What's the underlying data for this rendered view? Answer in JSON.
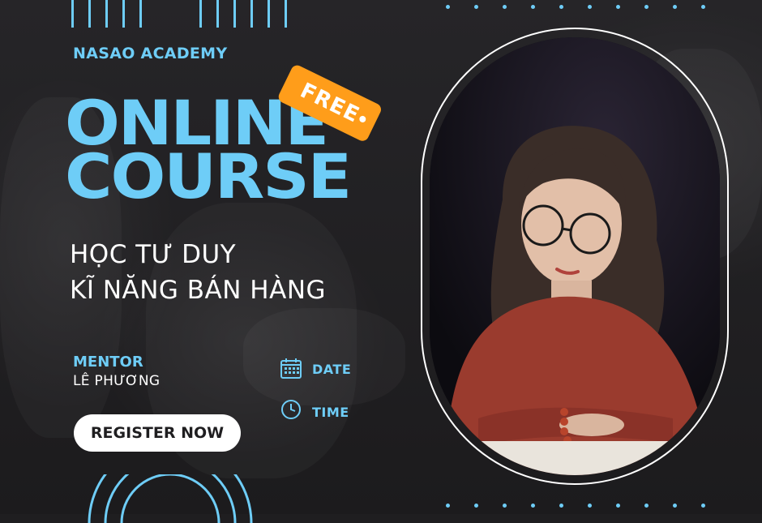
{
  "brand": {
    "academy": "NASAO ACADEMY"
  },
  "headline": {
    "line1": "ONLINE",
    "line2": "COURSE"
  },
  "tag": {
    "label": "FREE"
  },
  "subtitle": {
    "line1": "HỌC TƯ DUY",
    "line2": "KĨ NĂNG BÁN HÀNG"
  },
  "mentor": {
    "label": "MENTOR",
    "name": "LÊ PHƯƠNG"
  },
  "info": {
    "date_label": "DATE",
    "time_label": "TIME"
  },
  "cta": {
    "register_label": "REGISTER NOW"
  },
  "colors": {
    "accent": "#6ecdf7",
    "tag": "#ff9d1a",
    "background": "#1f1e20",
    "sweater": "#9a3b2e"
  },
  "icons": [
    "calendar-icon",
    "clock-icon"
  ]
}
